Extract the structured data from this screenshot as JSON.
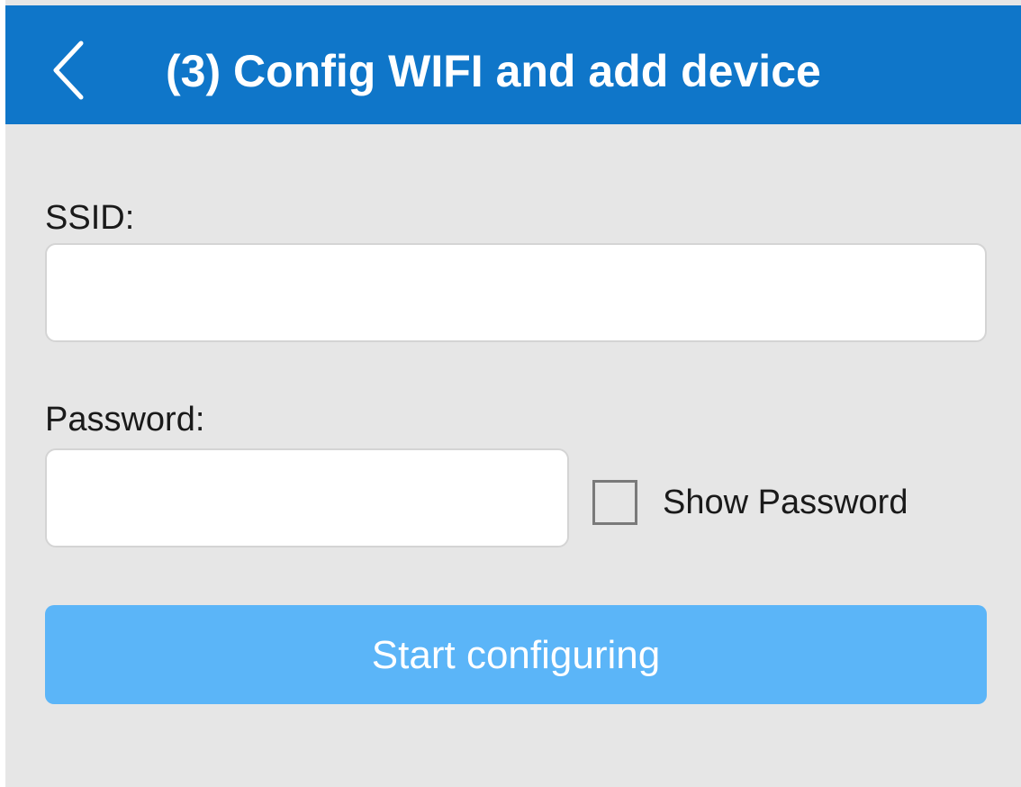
{
  "app_bar": {
    "back_icon": "chevron-left-icon",
    "title": "(3) Config WIFI and add device",
    "background_color": "#0f76c9"
  },
  "form": {
    "ssid": {
      "label": "SSID:",
      "value": ""
    },
    "password": {
      "label": "Password:",
      "value": ""
    },
    "show_password": {
      "label": "Show Password",
      "checked": false
    },
    "start_button": {
      "label": "Start configuring",
      "color": "#5bb5f8"
    }
  }
}
